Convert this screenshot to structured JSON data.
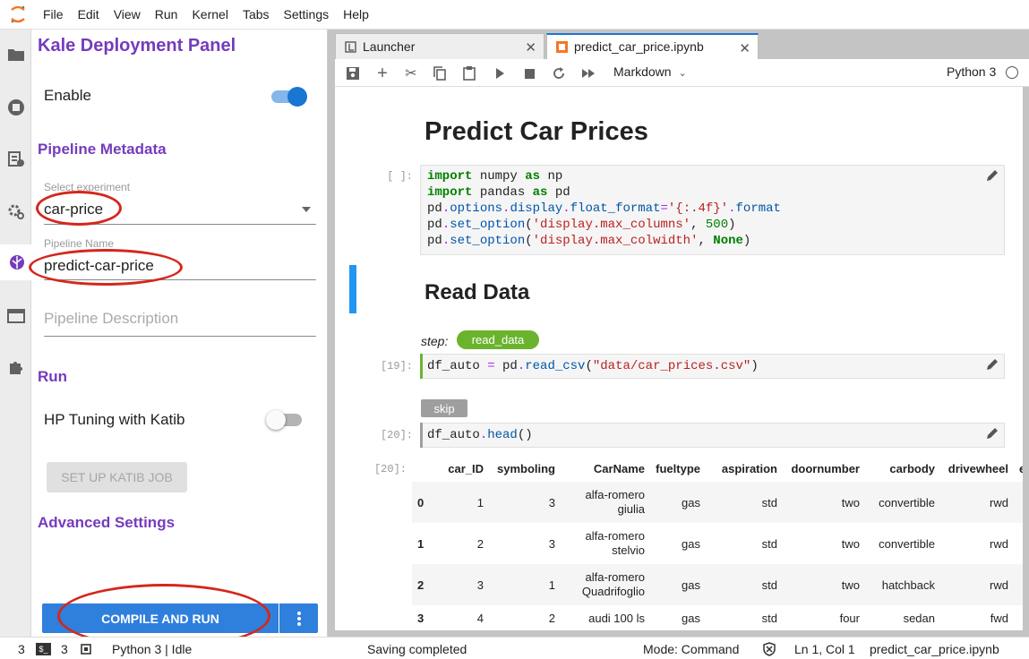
{
  "menubar": {
    "items": [
      "File",
      "Edit",
      "View",
      "Run",
      "Kernel",
      "Tabs",
      "Settings",
      "Help"
    ]
  },
  "kale": {
    "title": "Kale Deployment Panel",
    "enable_label": "Enable",
    "enable_on": true,
    "pipeline_metadata_header": "Pipeline Metadata",
    "experiment_label": "Select experiment",
    "experiment_value": "car-price",
    "pipeline_name_label": "Pipeline Name",
    "pipeline_name_value": "predict-car-price",
    "pipeline_description_placeholder": "Pipeline Description",
    "run_header": "Run",
    "hp_tuning_label": "HP Tuning with Katib",
    "hp_tuning_on": false,
    "katib_button": "SET UP KATIB JOB",
    "advanced_header": "Advanced Settings",
    "compile_button": "COMPILE AND RUN"
  },
  "tabs": [
    {
      "label": "Launcher",
      "active": false
    },
    {
      "label": "predict_car_price.ipynb",
      "active": true
    }
  ],
  "toolbar": {
    "cell_type": "Markdown",
    "kernel_name": "Python 3"
  },
  "notebook": {
    "heading1": "Predict Car Prices",
    "cell1_prompt": "[ ]:",
    "heading2": "Read Data",
    "step_label": "step:",
    "step_tag": "read_data",
    "cell2_prompt": "[19]:",
    "skip_tag": "skip",
    "cell3_prompt": "[20]:",
    "output_prompt": "[20]:",
    "table": {
      "columns": [
        "",
        "car_ID",
        "symboling",
        "CarName",
        "fueltype",
        "aspiration",
        "doornumber",
        "carbody",
        "drivewheel",
        "eng"
      ],
      "rows": [
        [
          "0",
          "1",
          "3",
          "alfa-romero giulia",
          "gas",
          "std",
          "two",
          "convertible",
          "rwd"
        ],
        [
          "1",
          "2",
          "3",
          "alfa-romero stelvio",
          "gas",
          "std",
          "two",
          "convertible",
          "rwd"
        ],
        [
          "2",
          "3",
          "1",
          "alfa-romero Quadrifoglio",
          "gas",
          "std",
          "two",
          "hatchback",
          "rwd"
        ],
        [
          "3",
          "4",
          "2",
          "audi 100 ls",
          "gas",
          "std",
          "four",
          "sedan",
          "fwd"
        ]
      ]
    }
  },
  "statusbar": {
    "terminals": "3",
    "kernels": "3",
    "kernel_status": "Python 3 | Idle",
    "message": "Saving completed",
    "mode": "Mode: Command",
    "position": "Ln 1, Col 1",
    "filename": "predict_car_price.ipynb"
  },
  "colors": {
    "kale_purple": "#753bbd",
    "toggle_blue": "#1976d2",
    "annotation_red": "#d4271b",
    "step_green": "#6ab42d"
  }
}
